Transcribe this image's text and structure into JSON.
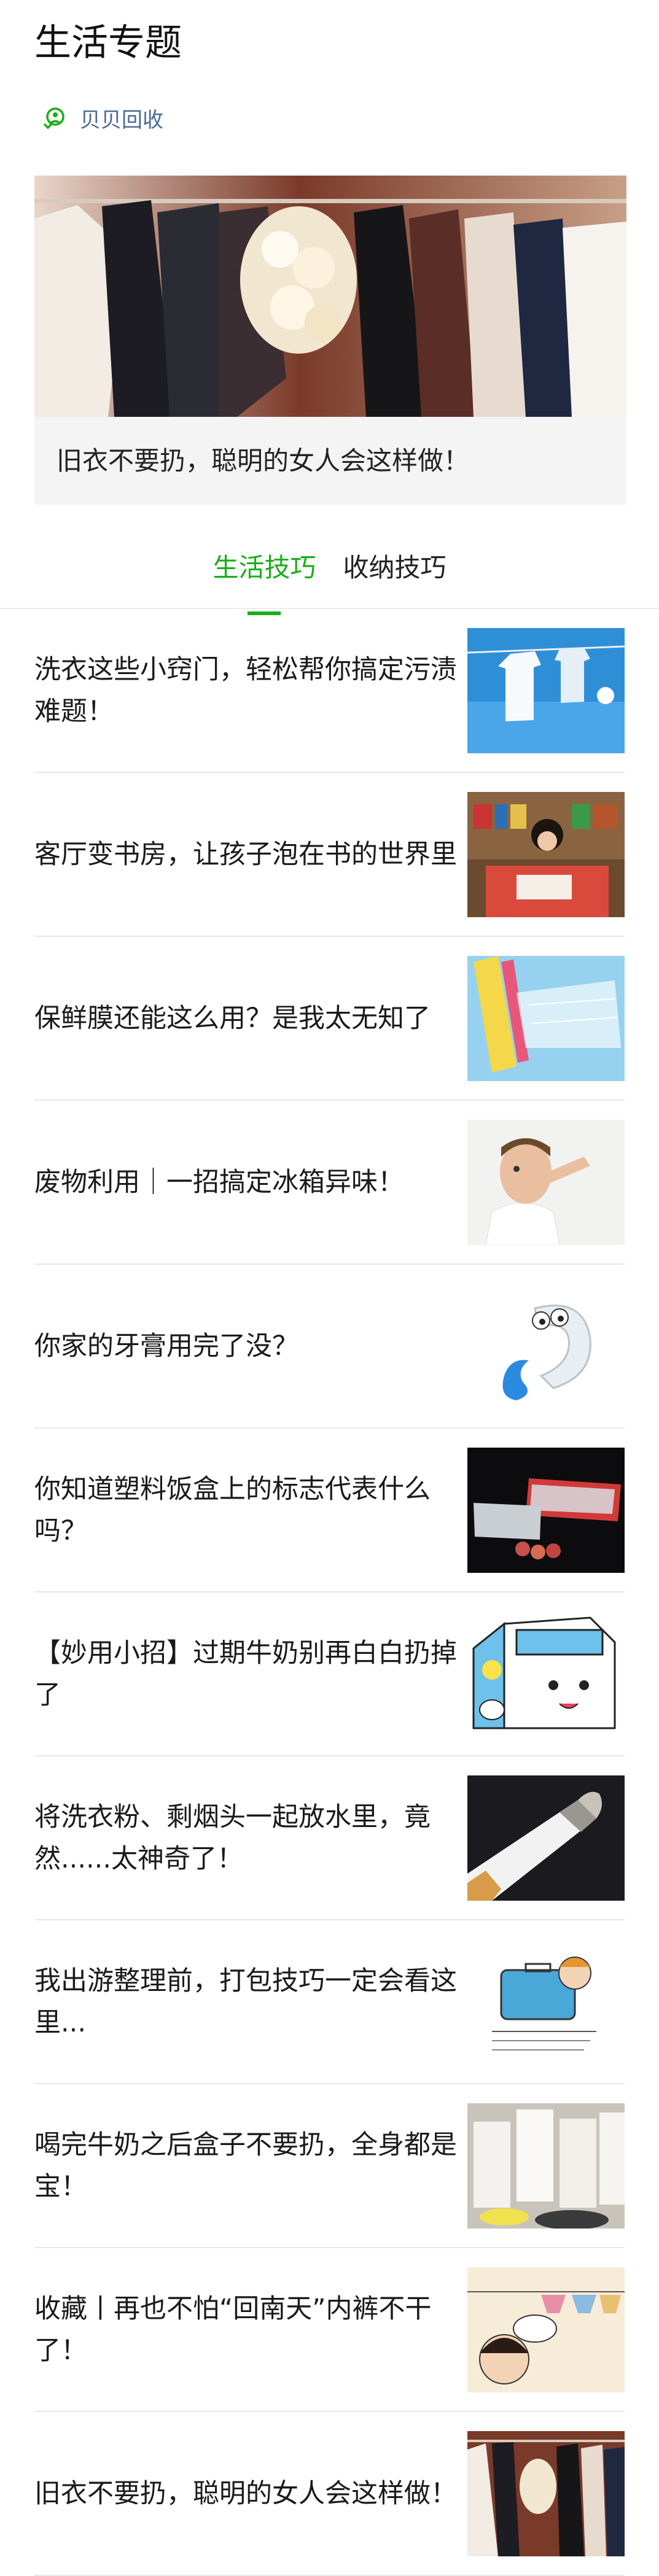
{
  "page": {
    "title": "生活专题"
  },
  "account": {
    "name": "贝贝回收",
    "logo_icon": "recycle-person-icon",
    "accent": "#1aad19"
  },
  "hero": {
    "caption": "旧衣不要扔，聪明的女人会这样做！",
    "image": "clothes-rack-image"
  },
  "tabs": [
    {
      "label": "生活技巧",
      "active": true
    },
    {
      "label": "收纳技巧",
      "active": false
    }
  ],
  "articles": [
    {
      "title": "洗衣这些小窍门，轻松帮你搞定污渍难题！",
      "thumb": "laundry-line-image"
    },
    {
      "title": "客厅变书房，让孩子泡在书的世界里",
      "thumb": "child-reading-room-image"
    },
    {
      "title": "保鲜膜还能这么用？是我太无知了",
      "thumb": "plastic-wrap-image"
    },
    {
      "title": "废物利用｜一招搞定冰箱异味！",
      "thumb": "man-holding-nose-image"
    },
    {
      "title": "你家的牙膏用完了没？",
      "thumb": "toothpaste-cartoon-image"
    },
    {
      "title": "你知道塑料饭盒上的标志代表什么吗？",
      "thumb": "plastic-lunchbox-image"
    },
    {
      "title": "【妙用小招】过期牛奶别再白白扔掉了",
      "thumb": "milk-carton-cartoon-image"
    },
    {
      "title": "将洗衣粉、剩烟头一起放水里，竟然......太神奇了！",
      "thumb": "cigarette-image"
    },
    {
      "title": "我出游整理前，打包技巧一定会看这里...",
      "thumb": "suitcase-cartoon-image"
    },
    {
      "title": "喝完牛奶之后盒子不要扔，全身都是宝！",
      "thumb": "milk-boxes-image"
    },
    {
      "title": "收藏丨再也不怕“回南天”内裤不干了！",
      "thumb": "underwear-cartoon-image"
    },
    {
      "title": "旧衣不要扔，聪明的女人会这样做！",
      "thumb": "clothes-rack-image"
    }
  ]
}
